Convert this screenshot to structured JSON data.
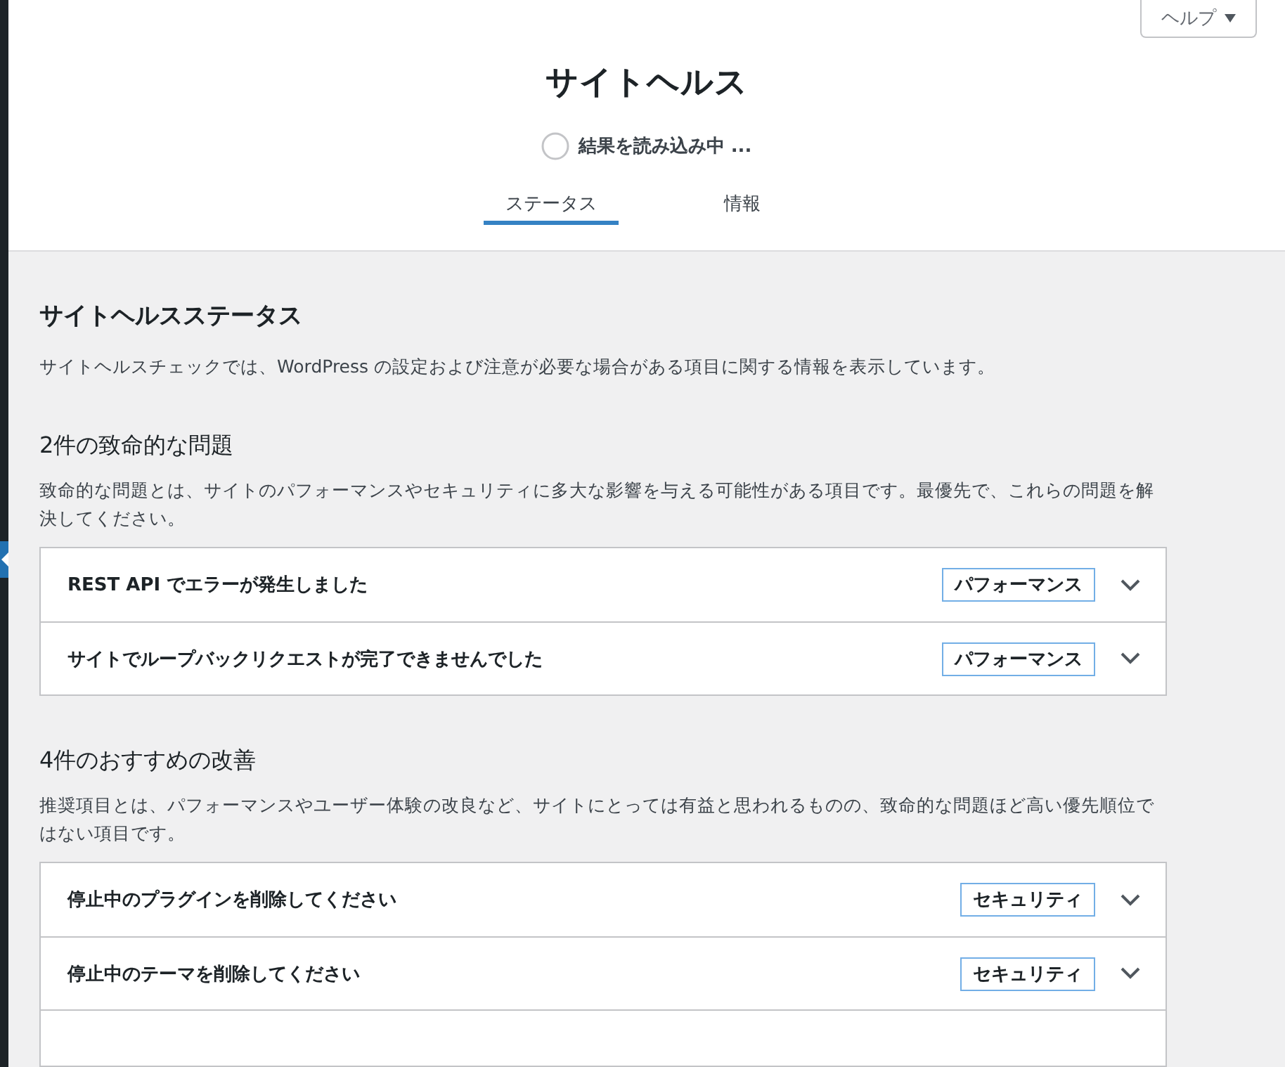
{
  "help_button": {
    "label": "ヘルプ"
  },
  "header": {
    "title": "サイトヘルス",
    "progress": {
      "label": "結果を読み込み中 ..."
    }
  },
  "tabs": [
    {
      "label": "ステータス",
      "selected": true
    },
    {
      "label": "情報",
      "selected": false
    }
  ],
  "status": {
    "title": "サイトヘルスステータス",
    "description": "サイトヘルスチェックでは、WordPress の設定および注意が必要な場合がある項目に関する情報を表示しています。"
  },
  "sections": [
    {
      "heading": "2件の致命的な問題",
      "description": "致命的な問題とは、サイトのパフォーマンスやセキュリティに多大な影響を与える可能性がある項目です。最優先で、これらの問題を解決してください。",
      "items": [
        {
          "title": "REST API でエラーが発生しました",
          "badge": "パフォーマンス",
          "expanded": false
        },
        {
          "title": "サイトでループバックリクエストが完了できませんでした",
          "badge": "パフォーマンス",
          "expanded": false
        }
      ]
    },
    {
      "heading": "4件のおすすめの改善",
      "description": "推奨項目とは、パフォーマンスやユーザー体験の改良など、サイトにとっては有益と思われるものの、致命的な問題ほど高い優先順位ではない項目です。",
      "items": [
        {
          "title": "停止中のプラグインを削除してください",
          "badge": "セキュリティ",
          "expanded": false
        },
        {
          "title": "停止中のテーマを削除してください",
          "badge": "セキュリティ",
          "expanded": false
        }
      ]
    }
  ]
}
